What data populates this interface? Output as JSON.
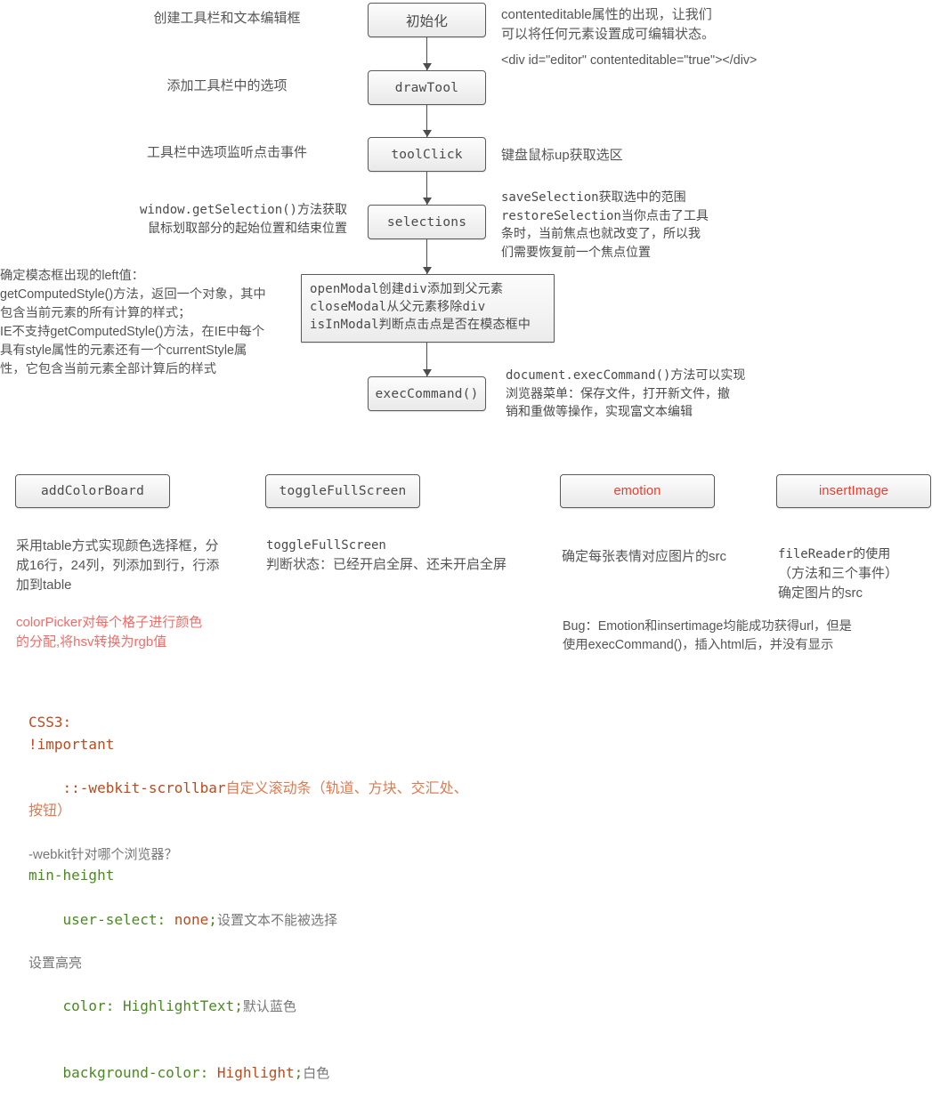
{
  "flow": {
    "nodes": [
      {
        "id": "init",
        "label": "初始化"
      },
      {
        "id": "drawtool",
        "label": "drawTool"
      },
      {
        "id": "toolclick",
        "label": "toolClick"
      },
      {
        "id": "selections",
        "label": "selections"
      },
      {
        "id": "modal",
        "label": "openModal创建div添加到父元素\ncloseModal从父元素移除div\nisInModal判断点击点是否在模态框中"
      },
      {
        "id": "execcommand",
        "label": "execCommand()"
      }
    ],
    "left_notes": [
      {
        "id": "note-create-toolbar",
        "text": "创建工具栏和文本编辑框"
      },
      {
        "id": "note-add-options",
        "text": "添加工具栏中的选项"
      },
      {
        "id": "note-listen-click",
        "text": "工具栏中选项监听点击事件"
      },
      {
        "id": "note-get-selection",
        "text": "window.getSelection()方法获取\n鼠标划取部分的起始位置和结束位置"
      },
      {
        "id": "note-computed-style",
        "text": "确定模态框出现的left值：\ngetComputedStyle()方法，返回一个对象，其中\n包含当前元素的所有计算的样式；\nIE不支持getComputedStyle()方法，在IE中每个\n具有style属性的元素还有一个currentStyle属\n性，它包含当前元素全部计算后的样式"
      }
    ],
    "right_notes": [
      {
        "id": "note-contenteditable",
        "text": "contenteditable属性的出现，让我们\n可以将任何元素设置成可编辑状态。"
      },
      {
        "id": "note-editor-div",
        "text": "<div id=\"editor\" contenteditable=\"true\"></div>"
      },
      {
        "id": "note-keyboard-mouse",
        "text": "键盘鼠标up获取选区"
      },
      {
        "id": "note-save-restore",
        "text": "saveSelection获取选中的范围\nrestoreSelection当你点击了工具\n条时，当前焦点也就改变了，所以我\n们需要恢复前一个焦点位置"
      },
      {
        "id": "note-execcommand",
        "text": "document.execCommand()方法可以实现\n浏览器菜单：保存文件，打开新文件，撤\n销和重做等操作，实现富文本编辑"
      }
    ]
  },
  "features": [
    {
      "id": "addcolorboard",
      "label": "addColorBoard",
      "label_color": "#4a4a4a",
      "desc": "采用table方式实现颜色选择框，分\n成16行，24列，列添加到行，行添\n加到table",
      "note_red": "colorPicker对每个格子进行颜色\n的分配,将hsv转换为rgb值"
    },
    {
      "id": "togglefullscreen",
      "label": "toggleFullScreen",
      "label_color": "#4a4a4a",
      "desc_mono": "toggleFullScreen",
      "desc": "判断状态：已经开启全屏、还未开启全屏",
      "note_red": ""
    },
    {
      "id": "emotion",
      "label": "emotion",
      "label_color": "#f03a2a",
      "desc": "确定每张表情对应图片的src",
      "note_red": ""
    },
    {
      "id": "insertimage",
      "label": "insertImage",
      "label_color": "#f03a2a",
      "desc_mono": "fileReader的使用",
      "desc": "（方法和三个事件）\n确定图片的src",
      "note_red": ""
    }
  ],
  "bug_note": "Bug：Emotion和insertimage均能成功获得url，但是\n使用execCommand()，插入html后，并没有显示",
  "css3_block": {
    "title": "CSS3:",
    "lines": [
      {
        "id": "line-important",
        "code": "!important",
        "tail": "",
        "style": "orange"
      },
      {
        "id": "line-scrollbar",
        "code": "::-webkit-scrollbar",
        "tail": "自定义滚动条（轨道、方块、交汇处、\n按钮）",
        "style": "orange-tail"
      },
      {
        "id": "line-webkit-q",
        "code": "-webkit针对哪个浏览器？",
        "tail": "",
        "style": "grey"
      },
      {
        "id": "line-min-height",
        "code": "min-height",
        "tail": "",
        "style": "green"
      },
      {
        "id": "line-user-select",
        "code": "user-select: ",
        "value": "none",
        "semi": ";",
        "tail": "设置文本不能被选择",
        "style": "green-value"
      },
      {
        "id": "line-highlight",
        "code": "设置高亮",
        "tail": "",
        "style": "grey"
      },
      {
        "id": "line-color",
        "code": "color: HighlightText",
        "semi": ";",
        "tail": "默认蓝色",
        "style": "green-semi"
      },
      {
        "id": "line-bgcolor",
        "code": "background-color: ",
        "value": "Highlight",
        "semi": ";",
        "tail": "白色",
        "style": "green-value"
      }
    ]
  }
}
